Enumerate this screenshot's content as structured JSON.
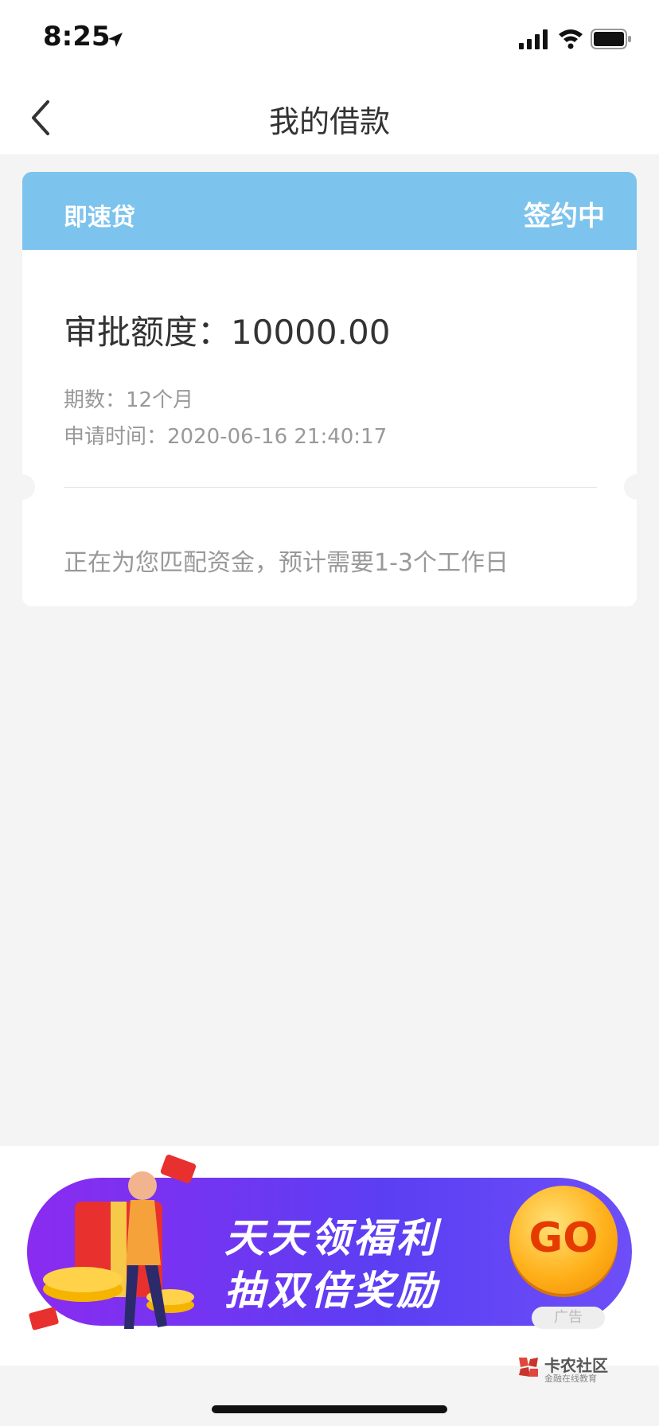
{
  "status_bar": {
    "time": "8:25"
  },
  "nav": {
    "title": "我的借款"
  },
  "loan_card": {
    "product": "即速贷",
    "status": "签约中",
    "amount_label": "审批额度：",
    "amount_value": "10000.00",
    "term_label": "期数：",
    "term_value": "12个月",
    "apply_time_label": "申请时间：",
    "apply_time_value": "2020-06-16 21:40:17",
    "progress_note": "正在为您匹配资金，预计需要1-3个工作日"
  },
  "banner": {
    "line1": "天天领福利",
    "line2": "抽双倍奖励",
    "go_label": "GO",
    "ad_tag": "广告"
  },
  "watermark": {
    "name": "卡农社区",
    "sub": "金融在线教育"
  },
  "colors": {
    "card_header": "#7cc3ee",
    "banner_purple": "#6d4ef8",
    "go_orange": "#ffb11b"
  }
}
